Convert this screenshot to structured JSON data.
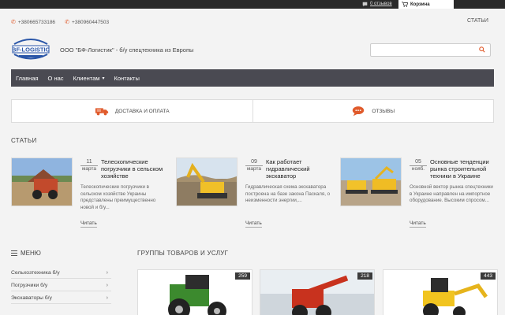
{
  "topbar": {
    "reviews_label": "0 отзывов",
    "cart_label": "Корзина"
  },
  "contacts": {
    "phone1": "+380665733186",
    "phone2": "+380960447503"
  },
  "header": {
    "articles_link": "СТАТЬИ",
    "logo_text": "BF-LOGISTIC",
    "company": "ООО \"БФ-Логистик\" - б/у спецтехника из Европы",
    "search_placeholder": ""
  },
  "nav": {
    "items": [
      {
        "label": "Главная"
      },
      {
        "label": "О нас"
      },
      {
        "label": "Клиентам",
        "has_dropdown": true
      },
      {
        "label": "Контакты"
      }
    ]
  },
  "services": [
    {
      "label": "ДОСТАВКА И ОПЛАТА",
      "icon": "truck-icon"
    },
    {
      "label": "ОТЗЫВЫ",
      "icon": "chat-bubble-icon"
    }
  ],
  "articles": {
    "title": "СТАТЬИ",
    "read_more": "Читать",
    "items": [
      {
        "day": "11",
        "month": "марта",
        "title": "Телескопические погрузчики в сельском хозяйстве",
        "desc": "Телескопические погрузчики в сельском хозяйстве Украины представлены преимущественно новой и б/у..."
      },
      {
        "day": "09",
        "month": "марта",
        "title": "Как работает гидравлический экскаватор",
        "desc": "Гидравлическая схема экскаватора построена на базе закона Паскаля, о неизменности энергии,..."
      },
      {
        "day": "05",
        "month": "нояб.",
        "title": "Основные тенденции рынка строительной техники в Украине",
        "desc": "Основной вектор рынка спецтехники в Украине направлен на импортное оборудование. Высоким спросом..."
      }
    ]
  },
  "menu": {
    "title": "МЕНЮ",
    "items": [
      {
        "label": "Сельхозтехника б/у"
      },
      {
        "label": "Погрузчики б/у"
      },
      {
        "label": "Экскаваторы б/у"
      }
    ]
  },
  "groups": {
    "title": "ГРУППЫ ТОВАРОВ И УСЛУГ",
    "items": [
      {
        "count": "259"
      },
      {
        "count": "218"
      },
      {
        "count": "443"
      }
    ]
  },
  "colors": {
    "accent": "#e05a2b",
    "nav_bg": "#4a4a52",
    "topbar_bg": "#2a2a2a"
  }
}
